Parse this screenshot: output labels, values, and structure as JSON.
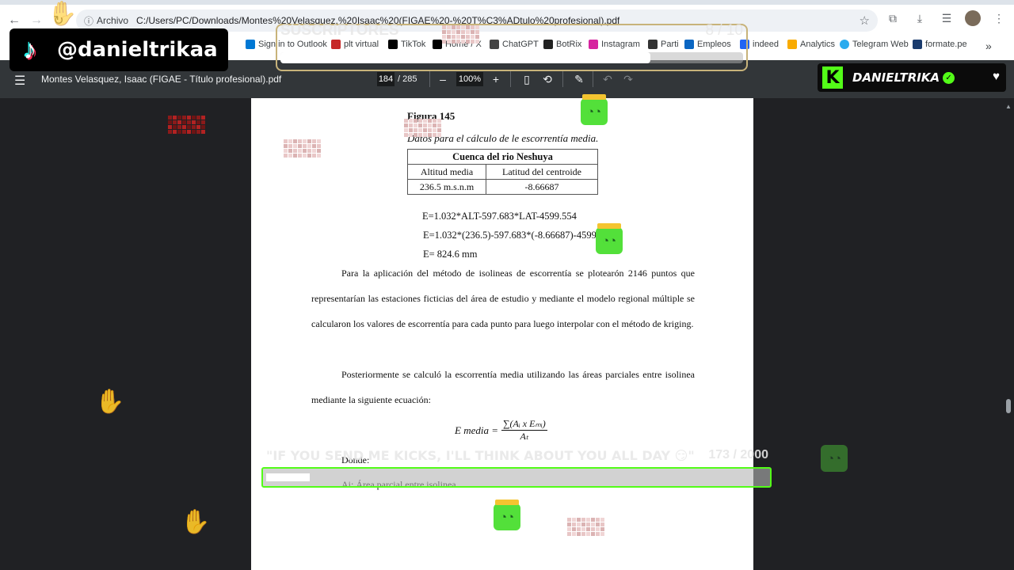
{
  "browser": {
    "address": {
      "security_chip": "Archivo",
      "url": "C:/Users/PC/Downloads/Montes%20Velasquez,%20Isaac%20(FIGAE%20-%20T%C3%ADtulo%20profesional).pdf"
    },
    "bookmarks": [
      {
        "label": "Sign in to Outlook",
        "color": "#0078d4"
      },
      {
        "label": "plt virtual",
        "color": "#c62828"
      },
      {
        "label": "TikTok",
        "color": "#000000"
      },
      {
        "label": "Home / X",
        "color": "#000000"
      },
      {
        "label": "ChatGPT",
        "color": "#444444"
      },
      {
        "label": "BotRix",
        "color": "#222222"
      },
      {
        "label": "Instagram",
        "color": "#d6249f"
      },
      {
        "label": "Parti",
        "color": "#333333"
      },
      {
        "label": "Empleos",
        "color": "#0a66c2"
      },
      {
        "label": "indeed",
        "color": "#2164f3"
      },
      {
        "label": "Analytics",
        "color": "#f9ab00"
      },
      {
        "label": "Telegram Web",
        "color": "#2aabee"
      },
      {
        "label": "formate.pe",
        "color": "#1a3b6d"
      }
    ],
    "bookmarks_overflow": "»"
  },
  "pdf_toolbar": {
    "title": "Montes Velasquez, Isaac (FIGAE - Título profesional).pdf",
    "current_page": "184",
    "total_pages": "/ 285",
    "zoom": "100%",
    "zoom_out": "–",
    "zoom_in": "+"
  },
  "document": {
    "figure_title": "Figura 145",
    "figure_caption": "Datos para el cálculo de le escorrentía media.",
    "table": {
      "header": "Cuenca del rio Neshuya",
      "columns": [
        "Altitud media",
        "Latitud del centroide"
      ],
      "row": [
        "236.5 m.s.n.m",
        "-8.66687"
      ]
    },
    "equations": [
      "E=1.032*ALT-597.683*LAT-4599.554",
      "E=1.032*(236.5)-597.683*(-8.66687)-4599.554",
      "E= 824.6 mm"
    ],
    "paragraph1": "Para la aplicación del método de isolineas de escorrentía se plotearón 2146 puntos que representarían las estaciones ficticias del área de estudio y mediante el modelo regional múltiple se calcularon los valores de escorrentía para cada punto para luego interpolar con el método de kriging.",
    "paragraph2": "Posteriormente se calculó la escorrentía media utilizando las áreas parciales entre isolinea mediante la siguiente ecuación:",
    "formula_lhs": "E media =",
    "formula_num": "∑(Aᵢ x Eₘᵢ)",
    "formula_den": "Aₜ",
    "donde": "Donde:",
    "ai_def": "Ai: Área parcial entre isolinea."
  },
  "overlays": {
    "tiktok_handle": "@danieltrikaa",
    "subs_label": "SUSCRIPTORES",
    "subs_count": "8 / 10",
    "subs_progress": 0.8,
    "kick_name": "DANIELTRIKA",
    "kicks_message": "\"IF YOU SEND ME KICKS, I'LL THINK ABOUT YOU ALL DAY 😏\"",
    "kicks_count": "173 / 2000",
    "kicks_progress": 0.0865,
    "accent": "#53fc18"
  }
}
